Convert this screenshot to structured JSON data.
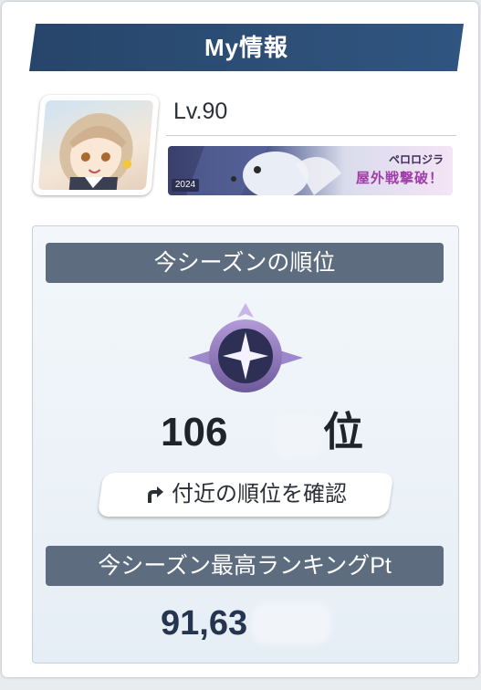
{
  "header": {
    "title": "My情報"
  },
  "profile": {
    "level": "Lv.90",
    "banner": {
      "year": "2024",
      "top_text": "ペロロジラ",
      "main_text": "屋外戦撃破！"
    }
  },
  "ranking": {
    "season_rank_title": "今シーズンの順位",
    "rank_value": "106",
    "rank_suffix": "位",
    "check_button": {
      "label": "付近の順位を確認",
      "icon": "curved-arrow-icon"
    },
    "season_best_title": "今シーズン最高ランキングPt",
    "season_best_points": "91,63"
  },
  "colors": {
    "header_bg": "#2d4f78",
    "pill_bg": "#5e6c7f",
    "points_text": "#25344f"
  }
}
